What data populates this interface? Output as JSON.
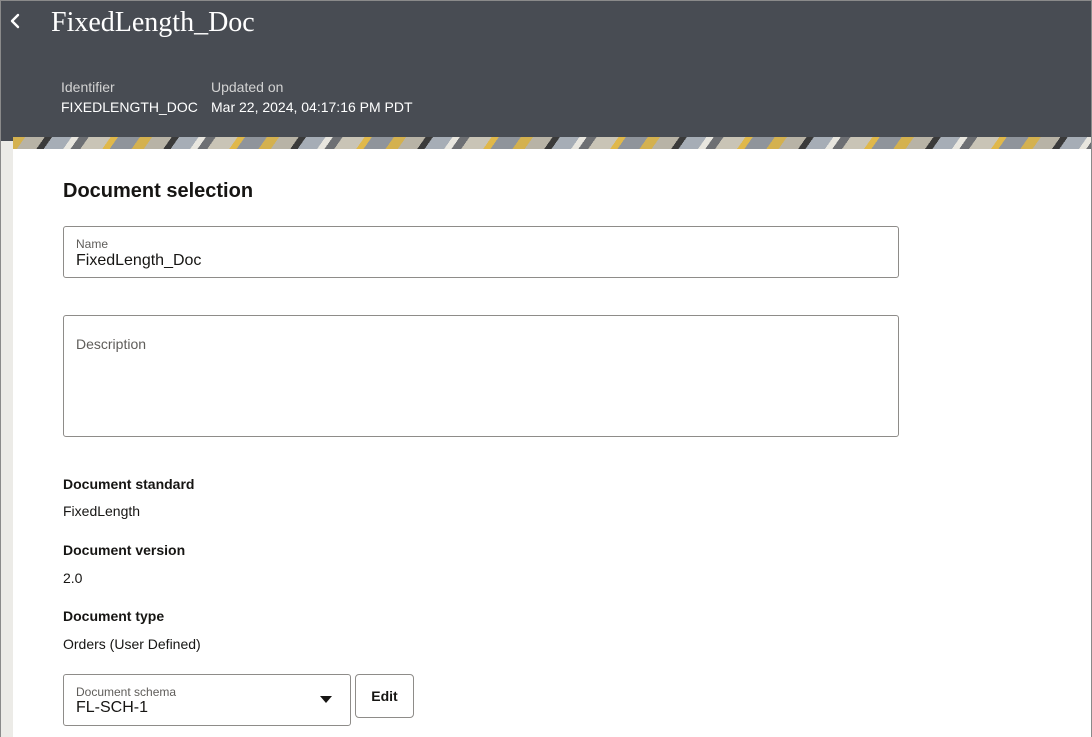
{
  "header": {
    "title": "FixedLength_Doc",
    "back_icon": "chevron-left-icon",
    "identifier_label": "Identifier",
    "identifier_value": "FIXEDLENGTH_DOC",
    "updated_label": "Updated on",
    "updated_value": "Mar 22, 2024, 04:17:16 PM PDT"
  },
  "section": {
    "title": "Document selection"
  },
  "form": {
    "name_label": "Name",
    "name_value": "FixedLength_Doc",
    "description_label": "Description",
    "description_value": "",
    "standard_label": "Document standard",
    "standard_value": "FixedLength",
    "version_label": "Document version",
    "version_value": "2.0",
    "type_label": "Document type",
    "type_value": "Orders (User Defined)",
    "schema_label": "Document schema",
    "schema_value": "FL-SCH-1",
    "edit_label": "Edit"
  },
  "colors": {
    "header_bg": "#484c53",
    "card_bg": "#ffffff",
    "text": "#161513",
    "border": "#8e8c89"
  }
}
